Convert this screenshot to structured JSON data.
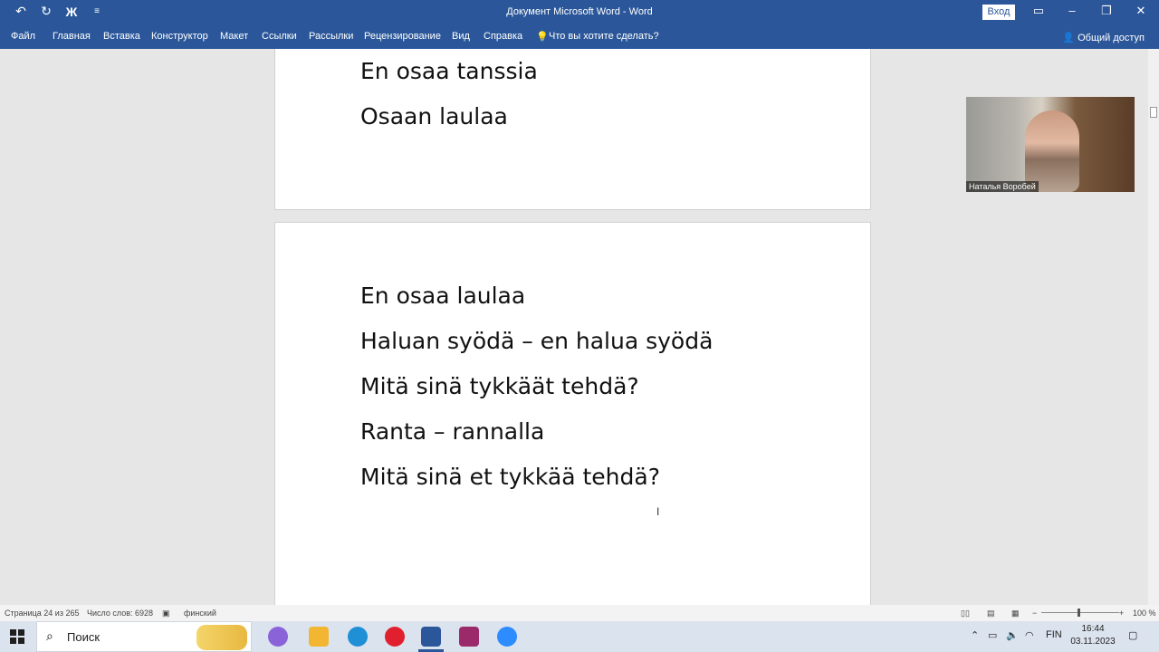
{
  "window": {
    "title": "Документ Microsoft Word  -  Word",
    "sign_in": "Вход"
  },
  "ribbon": {
    "tabs": [
      "Файл",
      "Главная",
      "Вставка",
      "Конструктор",
      "Макет",
      "Ссылки",
      "Рассылки",
      "Рецензирование",
      "Вид",
      "Справка",
      "Что вы хотите сделать?"
    ],
    "share": "Общий доступ"
  },
  "document": {
    "page1_lines": [
      "En osaa tanssia",
      "Osaan laulaa"
    ],
    "page2_lines": [
      "En osaa laulaa",
      "Haluan syödä – en halua syödä",
      "Mitä sinä tykkäät tehdä?",
      "Ranta – rannalla",
      "Mitä sinä et tykkää tehdä?"
    ]
  },
  "video": {
    "participant_name": "Наталья Воробей"
  },
  "statusbar": {
    "page": "Страница 24 из 265",
    "words": "Число слов: 6928",
    "language": "финский",
    "zoom": "100 %",
    "zoom_percent": 100
  },
  "taskbar": {
    "search_placeholder": "Поиск",
    "language": "FIN",
    "time": "16:44",
    "date": "03.11.2023"
  },
  "colors": {
    "word_blue": "#2b579a",
    "taskbar": "#dbe3ee"
  }
}
